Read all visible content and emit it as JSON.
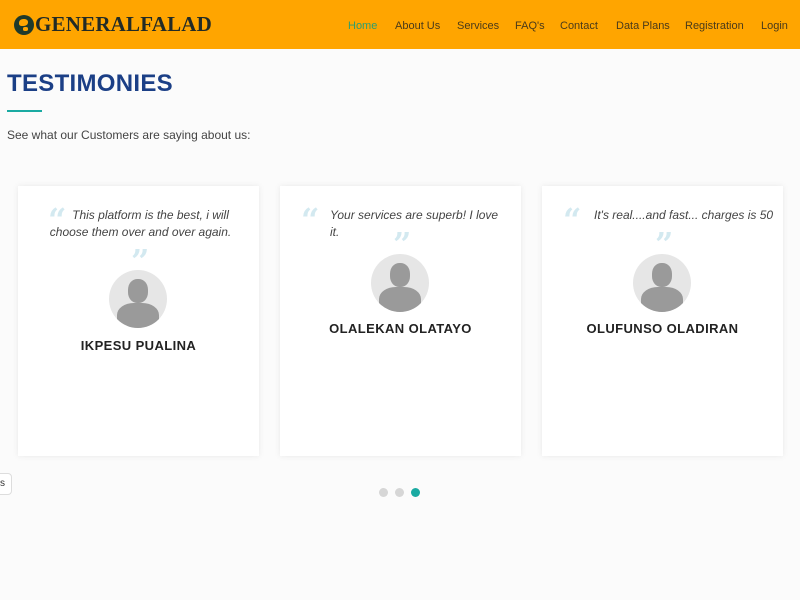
{
  "header": {
    "logo_text": "GENERALFALAD",
    "nav": [
      {
        "label": "Home",
        "active": true
      },
      {
        "label": "About Us",
        "active": false
      },
      {
        "label": "Services",
        "active": false
      },
      {
        "label": "FAQ's",
        "active": false
      },
      {
        "label": "Contact",
        "active": false
      },
      {
        "label": "Data Plans",
        "active": false
      },
      {
        "label": "Registration",
        "active": false
      },
      {
        "label": "Login",
        "active": false
      }
    ]
  },
  "section": {
    "title": "TESTIMONIES",
    "subtitle": "See what our Customers are saying about us:"
  },
  "testimonials": [
    {
      "quote": "This platform is the best, i will choose them over and over again.",
      "name": "IKPESU PUALINA"
    },
    {
      "quote": "Your services are superb! I love it.",
      "name": "OLALEKAN OLATAYO"
    },
    {
      "quote": "It's real....and fast... charges is 50",
      "name": "OLUFUNSO OLADIRAN"
    }
  ],
  "carousel": {
    "pages": 3,
    "active_index": 2
  },
  "side_tab": {
    "label": "s"
  },
  "colors": {
    "header_bg": "#ffa500",
    "title": "#1b3f86",
    "accent": "#1aaaa2",
    "nav_active": "#2e9e6e"
  }
}
